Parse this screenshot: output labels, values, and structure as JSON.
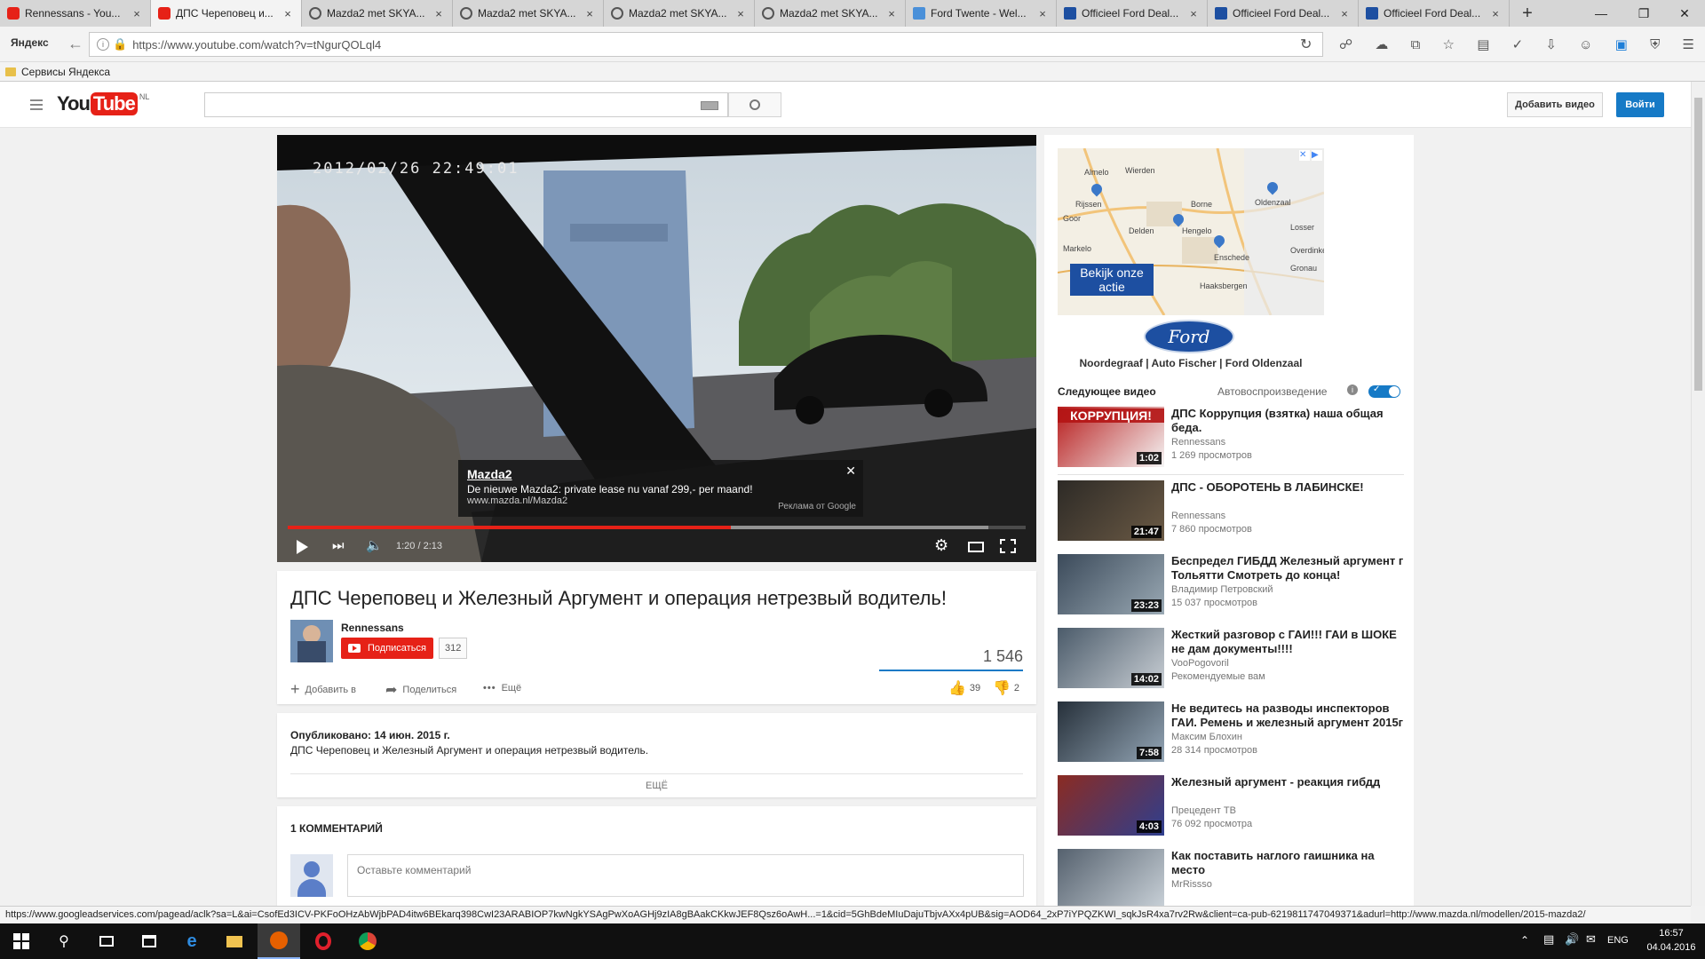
{
  "browser": {
    "tabs": [
      {
        "title": "Rennessans - You...",
        "icon": "youtube-icon",
        "active": false
      },
      {
        "title": "ДПС Череповец и...",
        "icon": "youtube-icon",
        "active": true
      },
      {
        "title": "Mazda2 met SKYA...",
        "icon": "mazda-icon",
        "active": false
      },
      {
        "title": "Mazda2 met SKYA...",
        "icon": "mazda-icon",
        "active": false
      },
      {
        "title": "Mazda2 met SKYA...",
        "icon": "mazda-icon",
        "active": false
      },
      {
        "title": "Mazda2 met SKYA...",
        "icon": "mazda-icon",
        "active": false
      },
      {
        "title": "Ford Twente - Wel...",
        "icon": "page-icon",
        "active": false
      },
      {
        "title": "Officieel Ford Deal...",
        "icon": "ford-icon",
        "active": false
      },
      {
        "title": "Officieel Ford Deal...",
        "icon": "ford-icon",
        "active": false
      },
      {
        "title": "Officieel Ford Deal...",
        "icon": "ford-icon",
        "active": false
      }
    ],
    "brand": "Яндекс",
    "url": "https://www.youtube.com/watch?v=tNgurQOLql4",
    "bookmarks_label": "Сервисы Яндекса",
    "status_url": "https://www.googleadservices.com/pagead/aclk?sa=L&ai=CsofEd3ICV-PKFoOHzAbWjbPAD4itw6BEkarq398CwI23ARABIOP7kwNgkYSAgPwXoAGHj9zIA8gBAakCKkwJEF8Qsz6oAwH...=1&cid=5GhBdeMIuDajuTbjvAXx4pUB&sig=AOD64_2xP7iYPQZKWI_sqkJsR4xa7rv2Rw&client=ca-pub-6219811747049371&adurl=http://www.mazda.nl/modellen/2015-mazda2/"
  },
  "youtube": {
    "logo_you": "You",
    "logo_tube": "Tube",
    "logo_region": "NL",
    "upload_label": "Добавить видео",
    "signin_label": "Войти"
  },
  "player": {
    "timestamp_overlay": "2012/02/26 22:49:01",
    "time": "1:20 / 2:13",
    "progress": 0.6,
    "buffered": 0.95,
    "ad_title": "Mazda2",
    "ad_text": "De nieuwe Mazda2: private lease nu vanaf 299,- per maand!",
    "ad_url": "www.mazda.nl/Mazda2",
    "ad_by": "Реклама от Google"
  },
  "video": {
    "title": "ДПС Череповец и Железный Аргумент и операция нетрезвый водитель!",
    "channel": "Rennessans",
    "subscribe_label": "Подписаться",
    "subscribers": "312",
    "views": "1 546",
    "add_to_label": "Добавить в",
    "share_label": "Поделиться",
    "more_label": "Ещё",
    "likes": "39",
    "dislikes": "2",
    "published": "Опубликовано: 14 июн. 2015 г.",
    "description": "ДПС Череповец и Железный Аргумент и операция нетрезвый водитель.",
    "show_more": "ЕЩЁ",
    "comments_header": "1 КОММЕНТАРИЙ",
    "comment_placeholder": "Оставьте комментарий"
  },
  "ad_sidebar": {
    "map_cities": [
      "Almelo",
      "Wierden",
      "Rijssen",
      "Borne",
      "Hengelo",
      "Oldenzaal",
      "Delden",
      "Enschede",
      "Markelo",
      "Haaksbergen",
      "Gronau",
      "Losser",
      "Overdinkel",
      "Goor"
    ],
    "cta": "Bekijk onze actie",
    "brand": "Ford",
    "dealers": "Noordegraaf | Auto Fischer | Ford Oldenzaal"
  },
  "next": {
    "up_next_label": "Следующее видео",
    "autoplay_label": "Автовоспроизведение",
    "autoplay_on": true,
    "items": [
      {
        "title": "ДПС Коррупция (взятка) наша общая беда.",
        "channel": "Rennessans",
        "views": "1 269 просмотров",
        "duration": "1:02",
        "thumb_text": "КОРРУПЦИЯ!"
      },
      {
        "title": "ДПС - ОБОРОТЕНЬ В ЛАБИНСКЕ!",
        "channel": "Rennessans",
        "views": "7 860 просмотров",
        "duration": "21:47",
        "thumb_text": ""
      },
      {
        "title": "Беспредел ГИБДД Железный аргумент г Тольятти Смотреть до конца!",
        "channel": "Владимир Петровский",
        "views": "15 037 просмотров",
        "duration": "23:23",
        "thumb_text": ""
      },
      {
        "title": "Жесткий разговор с ГАИ!!! ГАИ в ШОКЕ не дам документы!!!!",
        "channel": "VooPogovoril",
        "views": "Рекомендуемые вам",
        "duration": "14:02",
        "thumb_text": ""
      },
      {
        "title": "Не ведитесь на разводы инспекторов ГАИ. Ремень и железный аргумент 2015г",
        "channel": "Максим Блохин",
        "views": "28 314 просмотров",
        "duration": "7:58",
        "thumb_text": ""
      },
      {
        "title": "Железный аргумент - реакция гибдд",
        "channel": "Прецедент ТВ",
        "views": "76 092 просмотра",
        "duration": "4:03",
        "thumb_text": ""
      },
      {
        "title": "Как поставить наглого гаишника на место",
        "channel": "MrRissso",
        "views": "",
        "duration": "",
        "thumb_text": ""
      }
    ]
  },
  "taskbar": {
    "lang": "ENG",
    "time": "16:57",
    "date": "04.04.2016"
  },
  "colors": {
    "youtube_red": "#e62117",
    "accent_blue": "#167ac6"
  }
}
